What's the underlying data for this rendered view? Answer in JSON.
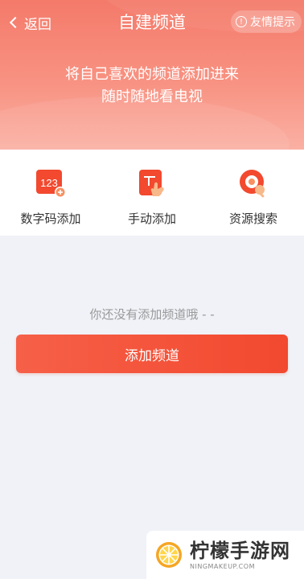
{
  "header": {
    "back_label": "返回",
    "title": "自建频道",
    "tips_label": "友情提示",
    "slogan_line1": "将自己喜欢的频道添加进来",
    "slogan_line2": "随时随地看电视"
  },
  "methods": [
    {
      "label": "数字码添加",
      "icon": "number-code-icon",
      "icon_text": "123"
    },
    {
      "label": "手动添加",
      "icon": "manual-add-icon"
    },
    {
      "label": "资源搜索",
      "icon": "resource-search-icon"
    }
  ],
  "empty_state": {
    "text": "你还没有添加频道哦 - -"
  },
  "add_button": {
    "label": "添加频道"
  },
  "watermark": {
    "brand_cn": "柠檬手游网",
    "brand_en": "NINGMAKEUP.COM"
  },
  "colors": {
    "accent": "#f2492f",
    "header": "#f47a6a",
    "background": "#f0f2f7"
  }
}
